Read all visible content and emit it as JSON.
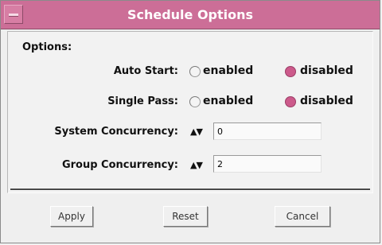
{
  "window": {
    "title": "Schedule Options"
  },
  "options": {
    "heading": "Options:",
    "auto_start": {
      "label": "Auto Start:",
      "enabled_label": "enabled",
      "disabled_label": "disabled",
      "selected": "disabled"
    },
    "single_pass": {
      "label": "Single Pass:",
      "enabled_label": "enabled",
      "disabled_label": "disabled",
      "selected": "disabled"
    },
    "system_concurrency": {
      "label": "System Concurrency:",
      "value": "0"
    },
    "group_concurrency": {
      "label": "Group Concurrency:",
      "value": "2"
    },
    "spinner_glyph": "▲▼"
  },
  "buttons": {
    "apply": "Apply",
    "reset": "Reset",
    "cancel": "Cancel"
  },
  "colors": {
    "titlebar": "#cc6e97",
    "radio_selected": "#cc5a8b"
  }
}
